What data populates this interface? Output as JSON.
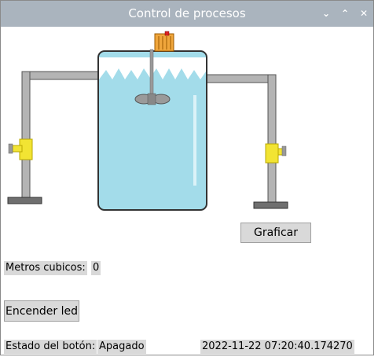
{
  "window": {
    "title": "Control de procesos",
    "controls": [
      "minimize-icon",
      "maximize-icon",
      "close-icon"
    ],
    "titlebar_color": "#aab4be"
  },
  "actions": {
    "graficar_label": "Graficar",
    "encender_led_label": "Encender led"
  },
  "metrics": {
    "metros_label": "Metros cubicos:",
    "metros_value": "0"
  },
  "status": {
    "estado_label": "Estado del botón:",
    "estado_value": "Apagado",
    "timestamp": "2022-11-22 07:20:40.174270"
  },
  "colors": {
    "water": "#a3dcea",
    "pipe": "#b4b4b4",
    "valve": "#f2e433",
    "motor": "#f0a63c"
  }
}
